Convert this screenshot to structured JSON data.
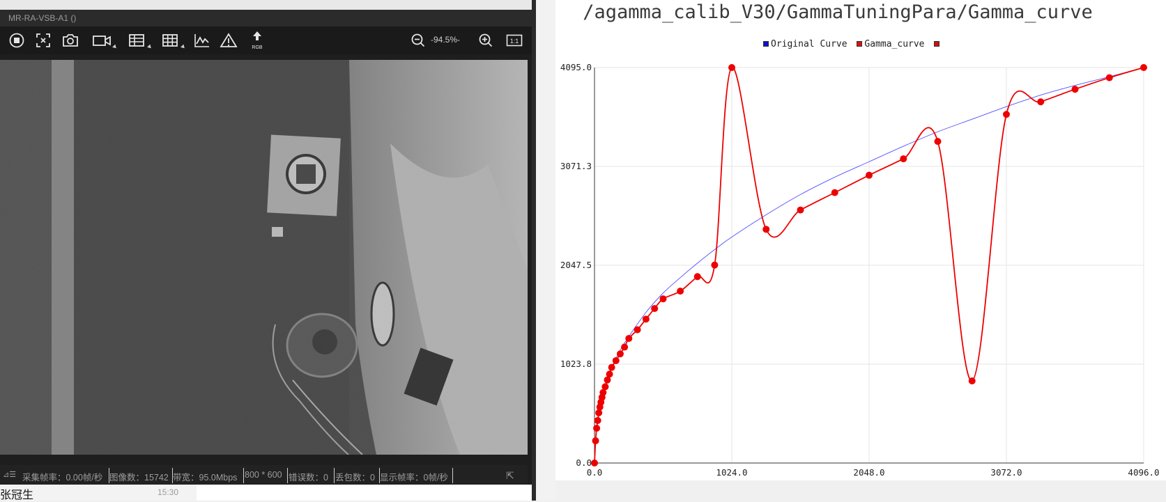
{
  "viewer": {
    "window_title": "MR-RA-VSB-A1 ()",
    "zoom_level": "-94.5%-",
    "toolbar_icons": [
      "stop-icon",
      "fit-selection-icon",
      "camera-icon",
      "video-icon",
      "table-icon",
      "grid-icon",
      "histogram-icon",
      "warning-icon",
      "rgb-upload-icon",
      "zoom-out-icon",
      "zoom-in-icon",
      "actual-size-icon"
    ],
    "rgb_label": "RGB",
    "actual_size_label": "1:1",
    "status": {
      "capture_fps": "采集帧率：0.00帧/秒",
      "image_count": "图像数：15742",
      "bandwidth": "带宽：95.0Mbps",
      "resolution": "800 * 600",
      "error_count": "错误数：0",
      "lost_packets": "丢包数：0",
      "display_fps": "显示帧率：0帧/秒"
    }
  },
  "chat": {
    "name": "张冠生",
    "time": "15:30"
  },
  "chart_data": {
    "type": "line",
    "title": "/agamma_calib_V30/GammaTuningPara/Gamma_curve",
    "legend": [
      "Original Curve",
      "Gamma_curve",
      ""
    ],
    "legend_colors": [
      "#1010d0",
      "#dd1111",
      "#cc1111"
    ],
    "legend_position": "top-center",
    "grid": true,
    "xlim": [
      0,
      4096
    ],
    "ylim": [
      0,
      4095
    ],
    "x_ticks": [
      "0.0",
      "1024.0",
      "2048.0",
      "3072.0",
      "4096.0"
    ],
    "y_ticks": [
      "0.0",
      "1023.8",
      "2047.5",
      "3071.3",
      "4095.0"
    ],
    "series": [
      {
        "name": "Original Curve",
        "color": "#5050ff",
        "x": [
          0,
          8,
          16,
          32,
          48,
          64,
          96,
          128,
          192,
          256,
          384,
          512,
          640,
          768,
          896,
          1024,
          1280,
          1536,
          1792,
          2048,
          2304,
          2560,
          2816,
          3072,
          3328,
          3584,
          3840,
          4096
        ],
        "y": [
          0,
          230,
          360,
          530,
          640,
          730,
          870,
          990,
          1170,
          1310,
          1560,
          1760,
          1920,
          2070,
          2210,
          2340,
          2570,
          2780,
          2960,
          3120,
          3280,
          3430,
          3560,
          3690,
          3810,
          3910,
          4000,
          4095
        ]
      },
      {
        "name": "Gamma_curve",
        "color": "#ee0000",
        "x": [
          0,
          8,
          16,
          24,
          32,
          40,
          48,
          56,
          64,
          80,
          96,
          112,
          128,
          160,
          192,
          224,
          256,
          320,
          384,
          448,
          512,
          640,
          768,
          896,
          1024,
          1280,
          1536,
          1792,
          2048,
          2304,
          2560,
          2816,
          3072,
          3328,
          3584,
          3840,
          4096
        ],
        "y": [
          0,
          230,
          360,
          440,
          520,
          580,
          630,
          680,
          730,
          790,
          860,
          920,
          990,
          1060,
          1130,
          1200,
          1290,
          1380,
          1490,
          1600,
          1700,
          1780,
          1930,
          2050,
          4095,
          2420,
          2620,
          2800,
          2980,
          3150,
          3330,
          850,
          3610,
          3740,
          3870,
          3990,
          4095
        ]
      }
    ]
  }
}
